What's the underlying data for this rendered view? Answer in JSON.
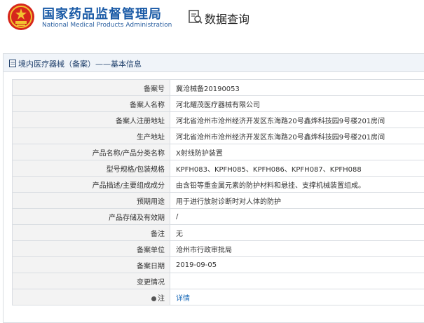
{
  "header": {
    "org_name_cn": "国家药品监督管理局",
    "org_name_en": "National Medical Products Administration",
    "query_title": "数据查询",
    "emblem_icon": "national-emblem-icon",
    "query_icon": "magnifier-document-icon",
    "brand_color": "#1a5aa6",
    "emblem_color": "#d6261c"
  },
  "panel": {
    "title": "境内医疗器械（备案）——基本信息",
    "title_icon": "document-icon"
  },
  "records": [
    {
      "label": "备案号",
      "value": "冀沧械备20190053"
    },
    {
      "label": "备案人名称",
      "value": "河北耀茂医疗器械有限公司"
    },
    {
      "label": "备案人注册地址",
      "value": "河北省沧州市沧州经济开发区东海路20号鑫烨科技园9号楼201房间"
    },
    {
      "label": "生产地址",
      "value": "河北省沧州市沧州经济开发区东海路20号鑫烨科技园9号楼201房间"
    },
    {
      "label": "产品名称/产品分类名称",
      "value": "X射线防护装置"
    },
    {
      "label": "型号规格/包装规格",
      "value": "KPFH083、KPFH085、KPFH086、KPFH087、KPFH088"
    },
    {
      "label": "产品描述/主要组成成分",
      "value": "由含铅等重金属元素的防护材料和悬挂、支撑机械装置组成。"
    },
    {
      "label": "预期用途",
      "value": "用于进行放射诊断时对人体的防护"
    },
    {
      "label": "产品存储及有效期",
      "value": "/"
    },
    {
      "label": "备注",
      "value": "无"
    },
    {
      "label": "备案单位",
      "value": "沧州市行政审批局"
    },
    {
      "label": "备案日期",
      "value": "2019-09-05"
    },
    {
      "label": "变更情况",
      "value": ""
    },
    {
      "label": "注",
      "value": "详情",
      "label_icon": "lightbulb-icon",
      "value_is_link": true
    }
  ]
}
